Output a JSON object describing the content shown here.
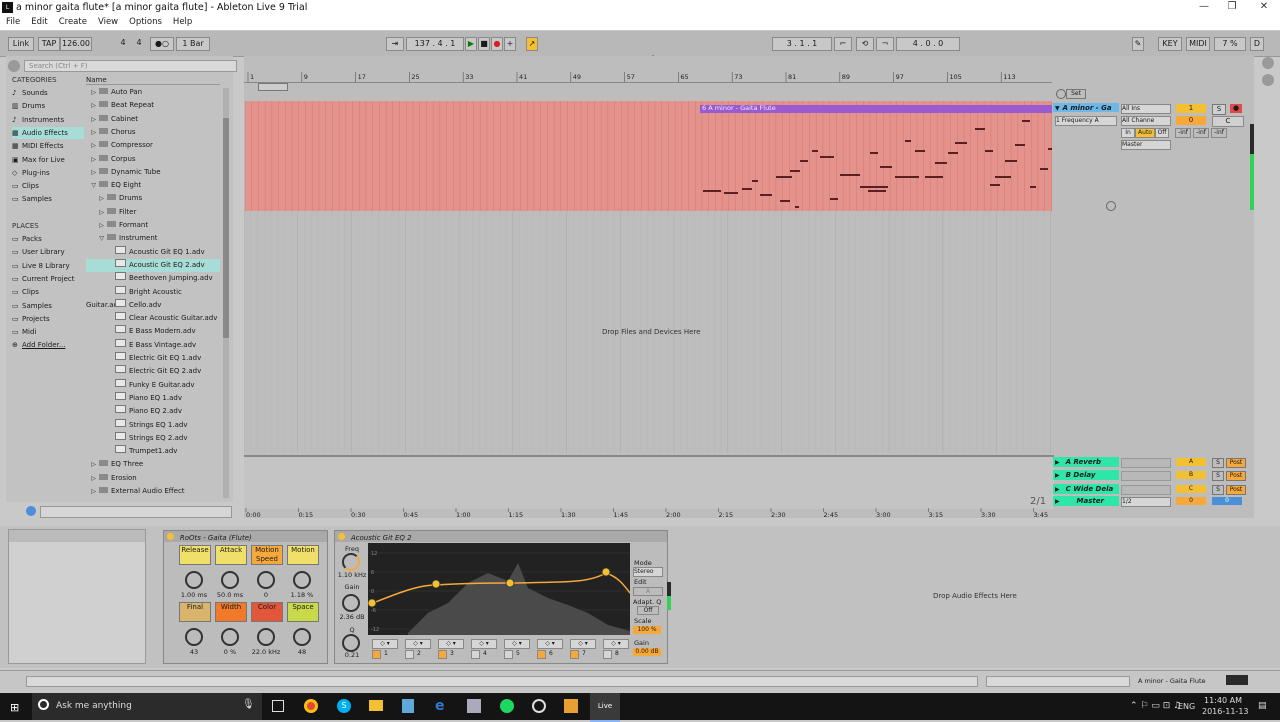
{
  "window": {
    "title": "a minor gaita flute*  [a minor gaita flute] - Ableton Live 9 Trial",
    "min": "—",
    "max": "❐",
    "close": "✕"
  },
  "menu": [
    "File",
    "Edit",
    "Create",
    "View",
    "Options",
    "Help"
  ],
  "transport": {
    "link": "Link",
    "tap": "TAP",
    "tempo": "126.00",
    "sig_a": "4",
    "sig_b": "4",
    "quant": "1 Bar",
    "position": "137 .  4 .  1",
    "loop_start": "3 .  1 .  1",
    "loop_len": "4 .  0 .  0",
    "key": "KEY",
    "midi": "MIDI",
    "cpu": "7 %",
    "d": "D"
  },
  "browser": {
    "search_placeholder": "Search (Ctrl + F)",
    "categories_title": "CATEGORIES",
    "categories": [
      "Sounds",
      "Drums",
      "Instruments",
      "Audio Effects",
      "MIDI Effects",
      "Max for Live",
      "Plug-ins",
      "Clips",
      "Samples"
    ],
    "places_title": "PLACES",
    "places": [
      "Packs",
      "User Library",
      "Live 8 Library",
      "Current Project",
      "Clips",
      "Samples",
      "Projects",
      "Midi",
      "Add Folder..."
    ],
    "name_header": "Name",
    "items": [
      {
        "label": "Auto Pan",
        "indent": 0,
        "type": "folder"
      },
      {
        "label": "Beat Repeat",
        "indent": 0,
        "type": "folder"
      },
      {
        "label": "Cabinet",
        "indent": 0,
        "type": "folder"
      },
      {
        "label": "Chorus",
        "indent": 0,
        "type": "folder"
      },
      {
        "label": "Compressor",
        "indent": 0,
        "type": "folder"
      },
      {
        "label": "Corpus",
        "indent": 0,
        "type": "folder"
      },
      {
        "label": "Dynamic Tube",
        "indent": 0,
        "type": "folder"
      },
      {
        "label": "EQ Eight",
        "indent": 0,
        "type": "open"
      },
      {
        "label": "Drums",
        "indent": 1,
        "type": "sub"
      },
      {
        "label": "Filter",
        "indent": 1,
        "type": "sub"
      },
      {
        "label": "Formant",
        "indent": 1,
        "type": "sub"
      },
      {
        "label": "Instrument",
        "indent": 1,
        "type": "subopen"
      },
      {
        "label": "Acoustic Git EQ 1.adv",
        "indent": 2,
        "type": "file"
      },
      {
        "label": "Acoustic Git EQ 2.adv",
        "indent": 2,
        "type": "file",
        "selected": true
      },
      {
        "label": "Beethoven Jumping.adv",
        "indent": 2,
        "type": "file"
      },
      {
        "label": "Bright Acoustic Guitar.adv",
        "indent": 2,
        "type": "file"
      },
      {
        "label": "Cello.adv",
        "indent": 2,
        "type": "file"
      },
      {
        "label": "Clear Acoustic Guitar.adv",
        "indent": 2,
        "type": "file"
      },
      {
        "label": "E Bass Modern.adv",
        "indent": 2,
        "type": "file"
      },
      {
        "label": "E Bass Vintage.adv",
        "indent": 2,
        "type": "file"
      },
      {
        "label": "Electric Git EQ 1.adv",
        "indent": 2,
        "type": "file"
      },
      {
        "label": "Electric Git EQ 2.adv",
        "indent": 2,
        "type": "file"
      },
      {
        "label": "Funky E Guitar.adv",
        "indent": 2,
        "type": "file"
      },
      {
        "label": "Piano EQ 1.adv",
        "indent": 2,
        "type": "file"
      },
      {
        "label": "Piano EQ 2.adv",
        "indent": 2,
        "type": "file"
      },
      {
        "label": "Strings EQ 1.adv",
        "indent": 2,
        "type": "file"
      },
      {
        "label": "Strings EQ 2.adv",
        "indent": 2,
        "type": "file"
      },
      {
        "label": "Trumpet1.adv",
        "indent": 2,
        "type": "file"
      },
      {
        "label": "EQ Three",
        "indent": 0,
        "type": "folder"
      },
      {
        "label": "Erosion",
        "indent": 0,
        "type": "folder"
      },
      {
        "label": "External Audio Effect",
        "indent": 0,
        "type": "folder"
      }
    ]
  },
  "arrangement": {
    "bar_ruler": [
      "1",
      "9",
      "17",
      "25",
      "33",
      "41",
      "49",
      "57",
      "65",
      "73",
      "81",
      "89",
      "97",
      "105",
      "113"
    ],
    "time_ruler": [
      "0:00",
      "0:15",
      "0:30",
      "0:45",
      "1:00",
      "1:15",
      "1:30",
      "1:45",
      "2:00",
      "2:15",
      "2:30",
      "2:45",
      "3:00",
      "3:15",
      "3:30",
      "3:45"
    ],
    "clip_name": "6 A minor - Gaita Flute",
    "drop_text": "Drop Files and Devices Here",
    "zoom": "2/1",
    "set_btn": "Set"
  },
  "tracks": {
    "main": {
      "name": "A minor - Ga",
      "input": "All Ins",
      "channel": "All Channe",
      "monitor_in": "In",
      "monitor_auto": "Auto",
      "monitor_off": "Off",
      "out": "Master",
      "num": "1",
      "solo": "S",
      "rec": "●",
      "vol": "0",
      "pan": "C",
      "v1": "-inf",
      "v2": "-inf",
      "v3": "-inf",
      "clip_box": "1 Frequency A"
    },
    "returns": [
      {
        "name": "A Reverb",
        "letter": "A",
        "solo": "S",
        "post": "Post"
      },
      {
        "name": "B Delay",
        "letter": "B",
        "solo": "S",
        "post": "Post"
      },
      {
        "name": "C Wide Dela",
        "letter": "C",
        "solo": "S",
        "post": "Post"
      }
    ],
    "master": {
      "name": "Master",
      "cue": "1/2",
      "vol": "0",
      "pan": "0"
    }
  },
  "devices": {
    "rack": {
      "title": "RoOts - Gaita (Flute)",
      "macros": [
        {
          "label": "Release",
          "value": "1.00 ms",
          "color": "#f0e06a"
        },
        {
          "label": "Attack",
          "value": "50.0 ms",
          "color": "#f0e06a"
        },
        {
          "label": "Motion Speed",
          "value": "0",
          "color": "#f7a83a"
        },
        {
          "label": "Motion",
          "value": "1.18 %",
          "color": "#f0e06a"
        },
        {
          "label": "Final",
          "value": "43",
          "color": "#d9b46c"
        },
        {
          "label": "Width",
          "value": "0 %",
          "color": "#f07a2a"
        },
        {
          "label": "Color",
          "value": "22.0 kHz",
          "color": "#e2573a"
        },
        {
          "label": "Space",
          "value": "48",
          "color": "#c9d94a"
        }
      ]
    },
    "eq": {
      "title": "Acoustic Git EQ 2",
      "freq_label": "Freq",
      "freq": "1.10 kHz",
      "gain_label": "Gain",
      "gain": "2.36 dB",
      "q_label": "Q",
      "q": "0.21",
      "mode_label": "Mode",
      "mode": "Stereo",
      "edit_label": "Edit",
      "edit": "A",
      "adapt_label": "Adapt. Q",
      "adapt": "Off",
      "scale_label": "Scale",
      "scale": "100 %",
      "gain2_label": "Gain",
      "gain2": "0.00 dB",
      "bands": [
        "1",
        "2",
        "3",
        "4",
        "5",
        "6",
        "7",
        "8"
      ],
      "axis": [
        "12",
        "6",
        "0",
        "-6",
        "-12"
      ]
    },
    "drop_text": "Drop Audio Effects Here"
  },
  "status": {
    "right": "A minor - Gaita Flute"
  },
  "taskbar": {
    "search": "Ask me anything",
    "time": "11:40 AM",
    "date": "2016-11-13",
    "lang": "ENG"
  },
  "colors": {
    "clip": "#e3928c",
    "track_head": "#6db8e8",
    "select": "#a8dcd7",
    "return_a": "#2fe6a8",
    "accent_orange": "#f7a83a"
  }
}
